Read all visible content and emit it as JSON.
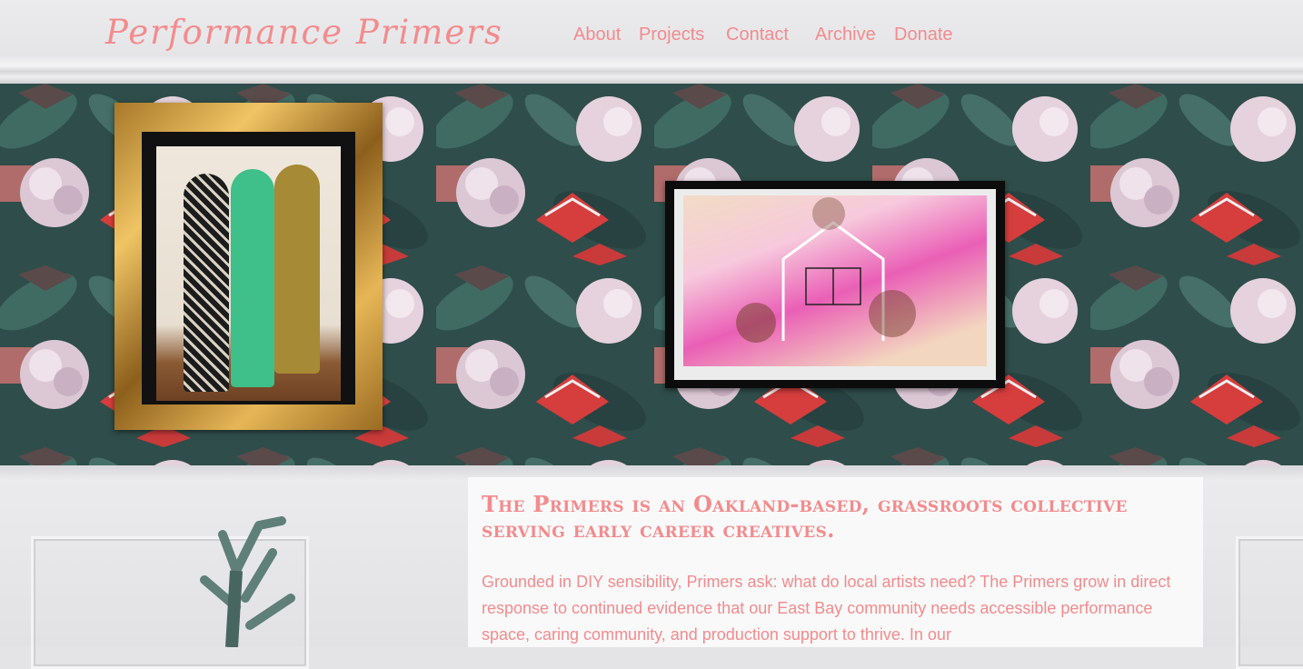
{
  "site": {
    "logo": "Performance Primers"
  },
  "nav": {
    "items": [
      {
        "id": "about",
        "label": "About"
      },
      {
        "id": "projects",
        "label": "Projects"
      },
      {
        "id": "contact",
        "label": "Contact"
      },
      {
        "id": "archive",
        "label": "Archive"
      },
      {
        "id": "donate",
        "label": "Donate"
      }
    ]
  },
  "main": {
    "tagline": "The Primers is an Oakland-based, grassroots collective serving early career creatives.",
    "body": "Grounded in DIY sensibility, Primers ask: what do local artists need? The Primers grow in direct response to continued evidence that our East Bay community needs accessible performance space, caring community, and production support to thrive. In our"
  },
  "colors": {
    "accent": "#f38b8d",
    "wallpaper_base": "#2e4a48",
    "wall": "#e4e4e6"
  },
  "images": {
    "photo": "group-photo-three-people",
    "painting": "pink-watercolor-house-painting",
    "wallpaper": "floral-butterfly-wallpaper",
    "plant": "cactus-plant"
  }
}
